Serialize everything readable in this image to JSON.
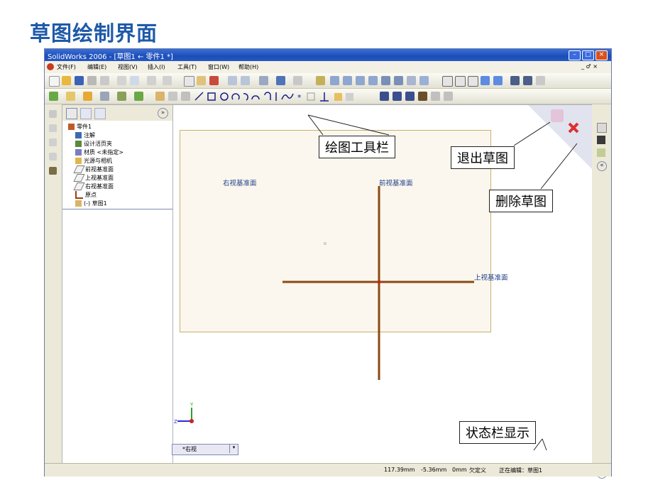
{
  "slide": {
    "title": "草图绘制界面"
  },
  "window": {
    "title": "SolidWorks 2006 - [草图1 ← 零件1 *]",
    "controls": {
      "minimize": "–",
      "maximize": "□",
      "close": "×"
    },
    "doc_controls": "_ ♂ ×"
  },
  "menu": {
    "items": [
      "文件(F)",
      "编辑(E)",
      "视图(V)",
      "插入(I)",
      "工具(T)",
      "窗口(W)",
      "帮助(H)"
    ]
  },
  "tree": {
    "root": "零件1",
    "items": [
      "注解",
      "设计活页夹",
      "材质 <未指定>",
      "光源与相机",
      "前视基准面",
      "上视基准面",
      "右视基准面",
      "原点",
      "(-) 草图1"
    ]
  },
  "panel": {
    "collapse": "»"
  },
  "planes": {
    "right": "右视基准面",
    "front": "前视基准面",
    "top": "上视基准面"
  },
  "callouts": {
    "draw_toolbar": "绘图工具栏",
    "exit_sketch": "退出草图",
    "delete_sketch": "删除草图",
    "status_bar": "状态栏显示"
  },
  "triad": {
    "y": "Y",
    "z": "Z"
  },
  "view_tab": {
    "label": "*右视"
  },
  "status": {
    "x": "117.39mm",
    "y": "-5.36mm",
    "z": "0mm",
    "state": "欠定义",
    "editing": "正在编辑：草图1"
  },
  "right_icons": {
    "expand": "«"
  },
  "colors": {
    "accent": "#1f5aa8",
    "titlebar": "#1c4db8",
    "sketch_line": "#8a4a10",
    "origin": "#cc2020"
  }
}
